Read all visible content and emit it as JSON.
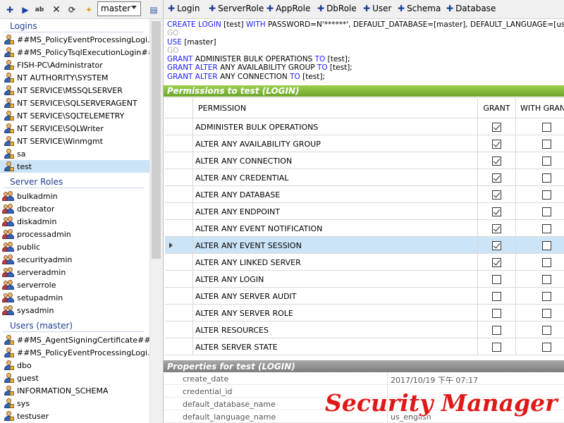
{
  "left_toolbar": {
    "database": "master"
  },
  "logins": {
    "header": "Logins",
    "items": [
      "##MS_PolicyEventProcessingLogi...",
      "##MS_PolicyTsqlExecutionLogin##",
      "FISH-PC\\Administrator",
      "NT AUTHORITY\\SYSTEM",
      "NT SERVICE\\MSSQLSERVER",
      "NT SERVICE\\SQLSERVERAGENT",
      "NT SERVICE\\SQLTELEMETRY",
      "NT SERVICE\\SQLWriter",
      "NT SERVICE\\Winmgmt",
      "sa",
      "test"
    ]
  },
  "server_roles": {
    "header": "Server Roles",
    "items": [
      "bulkadmin",
      "dbcreator",
      "diskadmin",
      "processadmin",
      "public",
      "securityadmin",
      "serveradmin",
      "serverrole",
      "setupadmin",
      "sysadmin"
    ]
  },
  "users": {
    "header": "Users (master)",
    "items": [
      "##MS_AgentSigningCertificate##",
      "##MS_PolicyEventProcessingLogi...",
      "dbo",
      "guest",
      "INFORMATION_SCHEMA",
      "sys",
      "testuser"
    ]
  },
  "right_toolbar": {
    "login": "Login",
    "server_role": "ServerRole",
    "app_role": "AppRole",
    "db_role": "DbRole",
    "user": "User",
    "schema": "Schema",
    "database": "Database"
  },
  "sql": {
    "l1_kw": "CREATE LOGIN",
    "l1_a": " [test] ",
    "l1_kw2": "WITH",
    "l1_b": " PASSWORD=N'******', DEFAULT_DATABASE=[master], DEFAULT_LANGUAGE=[us_eng",
    "go": "GO",
    "l3_kw": "USE",
    "l3_a": " [master]",
    "l5_kw": "GRANT",
    "l5_a": " ADMINISTER BULK OPERATIONS ",
    "l5_kw2": "TO",
    "l5_b": " [test];",
    "l6_kw": "GRANT ALTER",
    "l6_a": " ANY AVAILABILITY GROUP ",
    "l6_kw2": "TO",
    "l6_b": " [test];",
    "l7_kw": "GRANT ALTER",
    "l7_a": " ANY CONNECTION ",
    "l7_kw2": "TO",
    "l7_b": " [test];"
  },
  "permissions": {
    "header": "Permissions to test (LOGIN)",
    "col_permission": "PERMISSION",
    "col_grant": "GRANT",
    "col_with_grant": "WITH GRANT",
    "rows": [
      {
        "name": "ADMINISTER BULK OPERATIONS",
        "grant": true,
        "with_grant": false
      },
      {
        "name": "ALTER ANY AVAILABILITY GROUP",
        "grant": true,
        "with_grant": false
      },
      {
        "name": "ALTER ANY CONNECTION",
        "grant": true,
        "with_grant": false
      },
      {
        "name": "ALTER ANY CREDENTIAL",
        "grant": true,
        "with_grant": false
      },
      {
        "name": "ALTER ANY DATABASE",
        "grant": true,
        "with_grant": false
      },
      {
        "name": "ALTER ANY ENDPOINT",
        "grant": true,
        "with_grant": false
      },
      {
        "name": "ALTER ANY EVENT NOTIFICATION",
        "grant": true,
        "with_grant": false
      },
      {
        "name": "ALTER ANY EVENT SESSION",
        "grant": true,
        "with_grant": false,
        "selected": true
      },
      {
        "name": "ALTER ANY LINKED SERVER",
        "grant": true,
        "with_grant": false
      },
      {
        "name": "ALTER ANY LOGIN",
        "grant": false,
        "with_grant": false
      },
      {
        "name": "ALTER ANY SERVER AUDIT",
        "grant": false,
        "with_grant": false
      },
      {
        "name": "ALTER ANY SERVER ROLE",
        "grant": false,
        "with_grant": false
      },
      {
        "name": "ALTER RESOURCES",
        "grant": false,
        "with_grant": false
      },
      {
        "name": "ALTER SERVER STATE",
        "grant": false,
        "with_grant": false
      }
    ]
  },
  "properties": {
    "header": "Properties for test (LOGIN)",
    "rows": [
      {
        "name": "create_date",
        "value": "2017/10/19 下午 07:17"
      },
      {
        "name": "credential_id",
        "value": ""
      },
      {
        "name": "default_database_name",
        "value": ""
      },
      {
        "name": "default_language_name",
        "value": "us_english"
      }
    ]
  },
  "watermark": "Security Manager",
  "colors": {
    "selection": "#cce4f7",
    "keyword": "#1a1aff",
    "group_header": "#1c3f94",
    "permissions_bar": "#7cb83a",
    "watermark": "#e01818"
  }
}
